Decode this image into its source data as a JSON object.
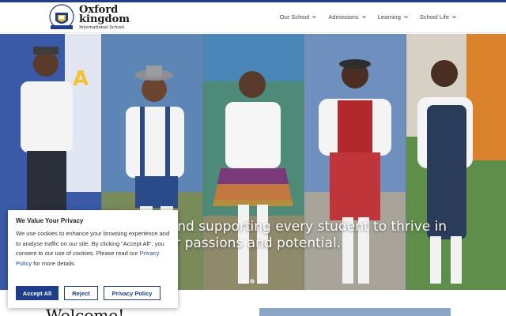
{
  "brand": {
    "name_line1": "Oxford",
    "name_line2": "kingdom",
    "tagline": "International School",
    "logo_arc_text": "OXFORD KINGDOM"
  },
  "nav": [
    {
      "label": "Our School"
    },
    {
      "label": "Admissions"
    },
    {
      "label": "Learning"
    },
    {
      "label": "School Life"
    }
  ],
  "hero": {
    "text_line1": "e and supporting every student to thrive in",
    "text_line2": "eir passions and potential.",
    "slides": 3,
    "active_slide": 1
  },
  "welcome": {
    "heading": "Welcome!"
  },
  "cookie": {
    "title": "We Value Your Privacy",
    "body": "We use cookies to enhance your browsing experience and to analyse traffic on our site. By clicking \"Accept All\", you consent to our use of cookies. Please read our ",
    "link": "Privacy Policy",
    "body_end": " for more details.",
    "accept_label": "Accept All",
    "reject_label": "Reject",
    "policy_label": "Privacy Policy"
  },
  "colors": {
    "brand_blue": "#1f3d8a",
    "link_blue": "#1d4fa0"
  }
}
